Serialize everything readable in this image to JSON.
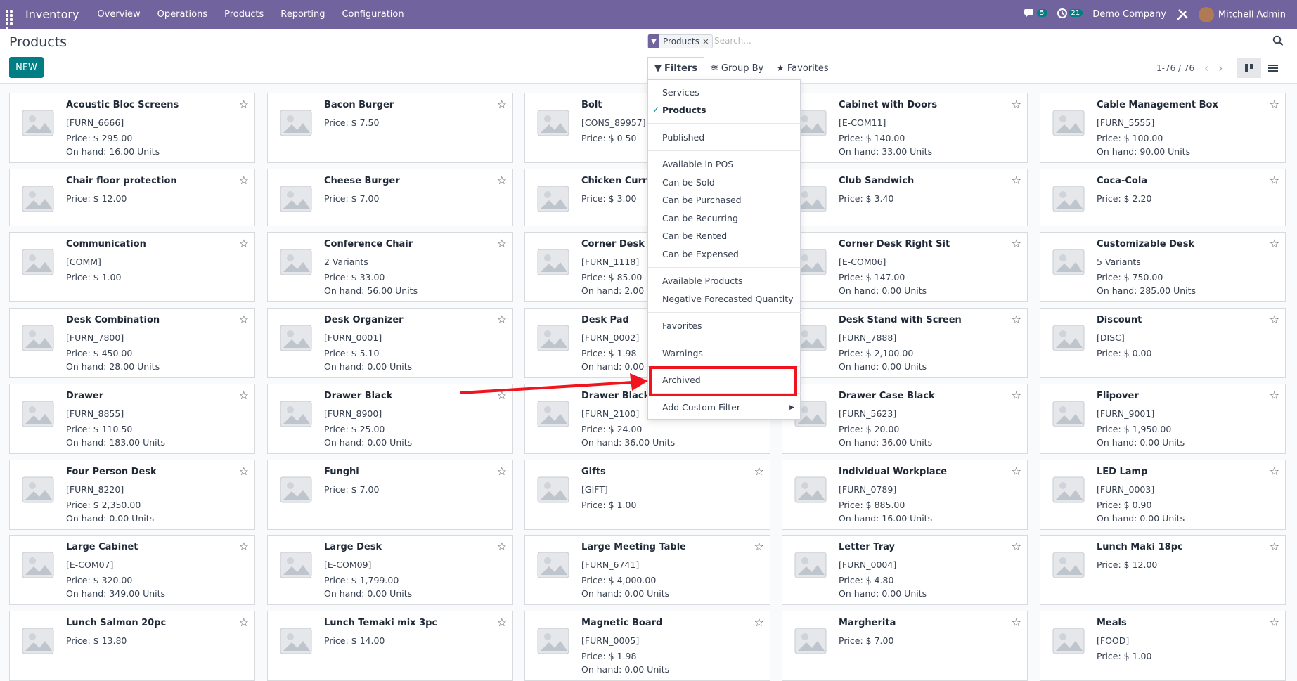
{
  "navbar": {
    "app_name": "Inventory",
    "menus": [
      "Overview",
      "Operations",
      "Products",
      "Reporting",
      "Configuration"
    ],
    "chat_count": "5",
    "activity_count": "21",
    "company": "Demo Company",
    "user": "Mitchell Admin",
    "color": "#71639e"
  },
  "control": {
    "title": "Products",
    "new_label": "NEW",
    "facet_label": "Products",
    "facet_remove": "×",
    "search_placeholder": "Search...",
    "filters_label": "Filters",
    "groupby_label": "Group By",
    "favorites_label": "Favorites",
    "pager": "1-76 / 76",
    "accent": "#017e84"
  },
  "dropdown": {
    "items": [
      {
        "label": "Services",
        "checked": false
      },
      {
        "label": "Products",
        "checked": true
      },
      {
        "label": "Published"
      },
      {
        "label": "Available in POS"
      },
      {
        "label": "Can be Sold"
      },
      {
        "label": "Can be Purchased"
      },
      {
        "label": "Can be Recurring"
      },
      {
        "label": "Can be Rented"
      },
      {
        "label": "Can be Expensed"
      },
      {
        "label": "Available Products"
      },
      {
        "label": "Negative Forecasted Quantity"
      },
      {
        "label": "Favorites"
      },
      {
        "label": "Warnings"
      },
      {
        "label": "Archived"
      },
      {
        "label": "Add Custom Filter"
      }
    ],
    "highlight_color": "#f0141e"
  },
  "products": [
    {
      "name": "Acoustic Bloc Screens",
      "lines": [
        "[FURN_6666]",
        "Price: $ 295.00",
        "On hand: 16.00 Units"
      ]
    },
    {
      "name": "Bacon Burger",
      "lines": [
        "Price: $ 7.50"
      ]
    },
    {
      "name": "Bolt",
      "lines": [
        "[CONS_89957]",
        "Price: $ 0.50"
      ]
    },
    {
      "name": "Cabinet with Doors",
      "lines": [
        "[E-COM11]",
        "Price: $ 140.00",
        "On hand: 33.00 Units"
      ]
    },
    {
      "name": "Cable Management Box",
      "lines": [
        "[FURN_5555]",
        "Price: $ 100.00",
        "On hand: 90.00 Units"
      ]
    },
    {
      "name": "Chair floor protection",
      "lines": [
        "Price: $ 12.00"
      ]
    },
    {
      "name": "Cheese Burger",
      "lines": [
        "Price: $ 7.00"
      ]
    },
    {
      "name": "Chicken Curry S",
      "lines": [
        "Price: $ 3.00"
      ]
    },
    {
      "name": "Club Sandwich",
      "lines": [
        "Price: $ 3.40"
      ]
    },
    {
      "name": "Coca-Cola",
      "lines": [
        "Price: $ 2.20"
      ]
    },
    {
      "name": "Communication",
      "lines": [
        "[COMM]",
        "Price: $ 1.00"
      ]
    },
    {
      "name": "Conference Chair",
      "lines": [
        "2 Variants",
        "Price: $ 33.00",
        "On hand: 56.00 Units"
      ]
    },
    {
      "name": "Corner Desk Lef",
      "lines": [
        "[FURN_1118]",
        "Price: $ 85.00",
        "On hand: 2.00 U"
      ]
    },
    {
      "name": "Corner Desk Right Sit",
      "lines": [
        "[E-COM06]",
        "Price: $ 147.00",
        "On hand: 0.00 Units"
      ]
    },
    {
      "name": "Customizable Desk",
      "lines": [
        "5 Variants",
        "Price: $ 750.00",
        "On hand: 285.00 Units"
      ]
    },
    {
      "name": "Desk Combination",
      "lines": [
        "[FURN_7800]",
        "Price: $ 450.00",
        "On hand: 28.00 Units"
      ]
    },
    {
      "name": "Desk Organizer",
      "lines": [
        "[FURN_0001]",
        "Price: $ 5.10",
        "On hand: 0.00 Units"
      ]
    },
    {
      "name": "Desk Pad",
      "lines": [
        "[FURN_0002]",
        "Price: $ 1.98",
        "On hand: 0.00 U"
      ]
    },
    {
      "name": "Desk Stand with Screen",
      "lines": [
        "[FURN_7888]",
        "Price: $ 2,100.00",
        "On hand: 0.00 Units"
      ]
    },
    {
      "name": "Discount",
      "lines": [
        "[DISC]",
        "Price: $ 0.00"
      ]
    },
    {
      "name": "Drawer",
      "lines": [
        "[FURN_8855]",
        "Price: $ 110.50",
        "On hand: 183.00 Units"
      ]
    },
    {
      "name": "Drawer Black",
      "lines": [
        "[FURN_8900]",
        "Price: $ 25.00",
        "On hand: 0.00 Units"
      ]
    },
    {
      "name": "Drawer Black",
      "lines": [
        "[FURN_2100]",
        "Price: $ 24.00",
        "On hand: 36.00 Units"
      ]
    },
    {
      "name": "Drawer Case Black",
      "lines": [
        "[FURN_5623]",
        "Price: $ 20.00",
        "On hand: 36.00 Units"
      ]
    },
    {
      "name": "Flipover",
      "lines": [
        "[FURN_9001]",
        "Price: $ 1,950.00",
        "On hand: 0.00 Units"
      ]
    },
    {
      "name": "Four Person Desk",
      "lines": [
        "[FURN_8220]",
        "Price: $ 2,350.00",
        "On hand: 0.00 Units"
      ]
    },
    {
      "name": "Funghi",
      "lines": [
        "Price: $ 7.00"
      ]
    },
    {
      "name": "Gifts",
      "lines": [
        "[GIFT]",
        "Price: $ 1.00"
      ]
    },
    {
      "name": "Individual Workplace",
      "lines": [
        "[FURN_0789]",
        "Price: $ 885.00",
        "On hand: 16.00 Units"
      ]
    },
    {
      "name": "LED Lamp",
      "lines": [
        "[FURN_0003]",
        "Price: $ 0.90",
        "On hand: 0.00 Units"
      ]
    },
    {
      "name": "Large Cabinet",
      "lines": [
        "[E-COM07]",
        "Price: $ 320.00",
        "On hand: 349.00 Units"
      ]
    },
    {
      "name": "Large Desk",
      "lines": [
        "[E-COM09]",
        "Price: $ 1,799.00",
        "On hand: 0.00 Units"
      ]
    },
    {
      "name": "Large Meeting Table",
      "lines": [
        "[FURN_6741]",
        "Price: $ 4,000.00",
        "On hand: 0.00 Units"
      ]
    },
    {
      "name": "Letter Tray",
      "lines": [
        "[FURN_0004]",
        "Price: $ 4.80",
        "On hand: 0.00 Units"
      ]
    },
    {
      "name": "Lunch Maki 18pc",
      "lines": [
        "Price: $ 12.00"
      ]
    },
    {
      "name": "Lunch Salmon 20pc",
      "lines": [
        "Price: $ 13.80"
      ]
    },
    {
      "name": "Lunch Temaki mix 3pc",
      "lines": [
        "Price: $ 14.00"
      ]
    },
    {
      "name": "Magnetic Board",
      "lines": [
        "[FURN_0005]",
        "Price: $ 1.98",
        "On hand: 0.00 Units"
      ]
    },
    {
      "name": "Margherita",
      "lines": [
        "Price: $ 7.00"
      ]
    },
    {
      "name": "Meals",
      "lines": [
        "[FOOD]",
        "Price: $ 1.00"
      ]
    }
  ]
}
